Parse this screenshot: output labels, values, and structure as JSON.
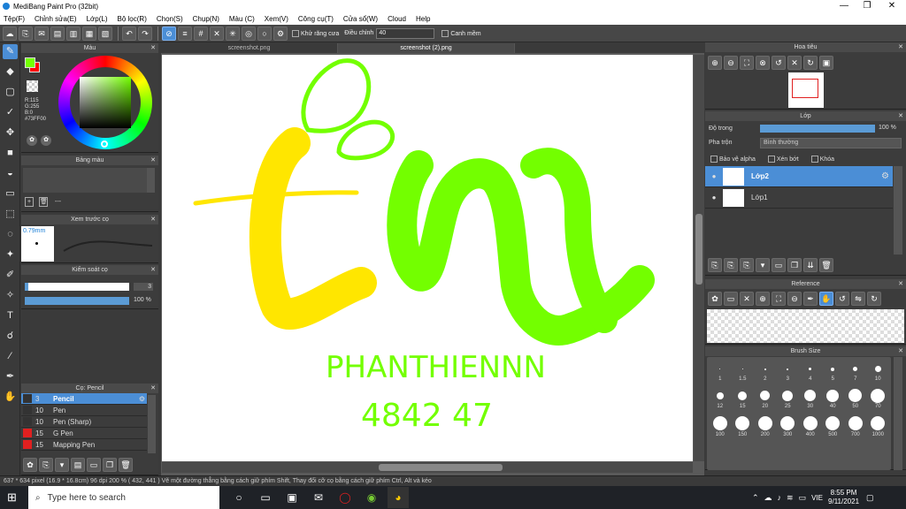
{
  "window": {
    "title": "MediBang Paint Pro (32bit)",
    "minimize": "—",
    "maximize": "❐",
    "close": "✕"
  },
  "menu": [
    "Tệp(F)",
    "Chỉnh sửa(E)",
    "Lớp(L)",
    "Bộ lọc(R)",
    "Chọn(S)",
    "Chụp(N)",
    "Màu (C)",
    "Xem(V)",
    "Công cụ(T)",
    "Cửa sổ(W)",
    "Cloud",
    "Help"
  ],
  "toolbar": {
    "antialias": "Khử răng cưa",
    "adjust": "Điều chỉnh",
    "adjust_value": "40",
    "snap": "Canh mềm"
  },
  "color_panel": {
    "title": "Màu",
    "r": "R:115",
    "g": "G:255",
    "b": "B:0",
    "hex": "#73FF00",
    "fg": "#73FF00",
    "bg": "#ff0000"
  },
  "palette_panel": {
    "title": "Bảng màu",
    "dash": "---"
  },
  "brush_preview": {
    "title": "Xem trước cọ",
    "size": "0.79mm"
  },
  "brush_control": {
    "title": "Kiểm soát cọ",
    "size_value": "3",
    "opacity_value": "100 %"
  },
  "brush_list": {
    "title": "Cọ: Pencil",
    "items": [
      {
        "size": "3",
        "name": "Pencil",
        "color": "#333333",
        "selected": true
      },
      {
        "size": "10",
        "name": "Pen",
        "color": "#333333",
        "selected": false
      },
      {
        "size": "10",
        "name": "Pen (Sharp)",
        "color": "#333333",
        "selected": false
      },
      {
        "size": "15",
        "name": "G Pen",
        "color": "#e02020",
        "selected": false
      },
      {
        "size": "15",
        "name": "Mapping Pen",
        "color": "#e02020",
        "selected": false
      }
    ]
  },
  "tabs": [
    "screenshot.png",
    "screenshot (2).png"
  ],
  "canvas_text": {
    "line1": "PHANTHIENNN",
    "line2": "4842 47"
  },
  "navigator": {
    "title": "Hoa tiêu"
  },
  "layer_panel": {
    "title": "Lớp",
    "opacity_label": "Độ trong",
    "opacity_value": "100 %",
    "blend_label": "Pha trộn",
    "blend_value": "Bình thường",
    "protect_alpha": "Bảo vệ alpha",
    "clipping": "Xén bớt",
    "lock": "Khóa",
    "layers": [
      "Lớp2",
      "Lớp1"
    ]
  },
  "reference_panel": {
    "title": "Reference"
  },
  "brush_size_panel": {
    "title": "Brush Size",
    "sizes": [
      "1",
      "1.5",
      "2",
      "3",
      "4",
      "5",
      "7",
      "10",
      "12",
      "15",
      "20",
      "25",
      "30",
      "40",
      "50",
      "70",
      "100",
      "150",
      "200",
      "300",
      "400",
      "500",
      "700",
      "1000"
    ]
  },
  "status": {
    "text": "637 * 634 pixel   (16.9 * 16.8cm)   96 dpi   200 %   ( 432, 441 )   Vẽ một đường thẳng bằng cách giữ phím Shift, Thay đổi cỡ cọ bằng cách giữ phím Ctrl, Alt và kéo"
  },
  "taskbar": {
    "search": "Type here to search",
    "lang": "VIE",
    "time": "8:55 PM",
    "date": "9/11/2021"
  }
}
